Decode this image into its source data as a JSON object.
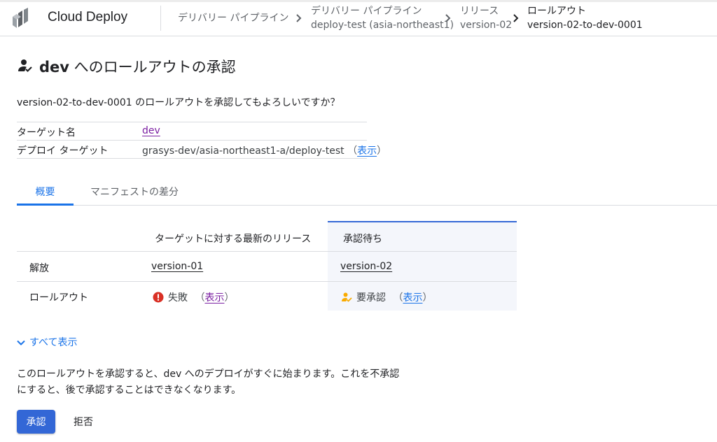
{
  "header": {
    "product_name": "Cloud Deploy",
    "breadcrumbs": [
      {
        "line1": "デリバリー パイプライン",
        "line2": ""
      },
      {
        "line1": "デリバリー パイプライン",
        "line2": "deploy-test (asia-northeast1)"
      },
      {
        "line1": "リリース",
        "line2": "version-02"
      },
      {
        "line1": "ロールアウト",
        "line2": "version-02-to-dev-0001"
      }
    ]
  },
  "page": {
    "title_target": "dev",
    "title_rest": " へのロールアウトの承認",
    "question": "version-02-to-dev-0001 のロールアウトを承認してもよろしいですか？"
  },
  "info": {
    "target_label": "ターゲット名",
    "target_value": "dev",
    "deploy_label": "デプロイ ターゲット",
    "deploy_value": "grasys-dev/asia-northeast1-a/deploy-test",
    "deploy_open": "（",
    "deploy_link": "表示",
    "deploy_close": "）"
  },
  "tabs": [
    {
      "label": "概要",
      "active": true
    },
    {
      "label": "マニフェストの差分",
      "active": false
    }
  ],
  "compare": {
    "col_latest": "ターゲットに対する最新のリリース",
    "col_pending": "承認待ち",
    "rows": [
      {
        "label": "解放",
        "latest": "version-01",
        "pending": "version-02"
      },
      {
        "label": "ロールアウト",
        "latest_status": "失敗",
        "latest_link": "表示",
        "pending_status": "要承認",
        "pending_link": "表示"
      }
    ],
    "paren_open": "（",
    "paren_close": "）"
  },
  "show_all": "すべて表示",
  "notice": {
    "line1": "このロールアウトを承認すると、dev へのデプロイがすぐに始まります。これを不承認",
    "line2": "にすると、後で承認することはできなくなります。"
  },
  "actions": {
    "approve": "承認",
    "reject": "拒否"
  },
  "colors": {
    "accent": "#1a73e8",
    "primary_button": "#3367d6",
    "error": "#d93025",
    "warning": "#f9ab00",
    "visited_link": "#7b1fa2"
  },
  "icons": {
    "logo": "cloud-deploy-logo",
    "title": "person-check-icon",
    "failed": "error-icon",
    "pending": "person-check-icon",
    "chevron": "chevron-right-icon",
    "expand": "chevron-down-icon"
  }
}
